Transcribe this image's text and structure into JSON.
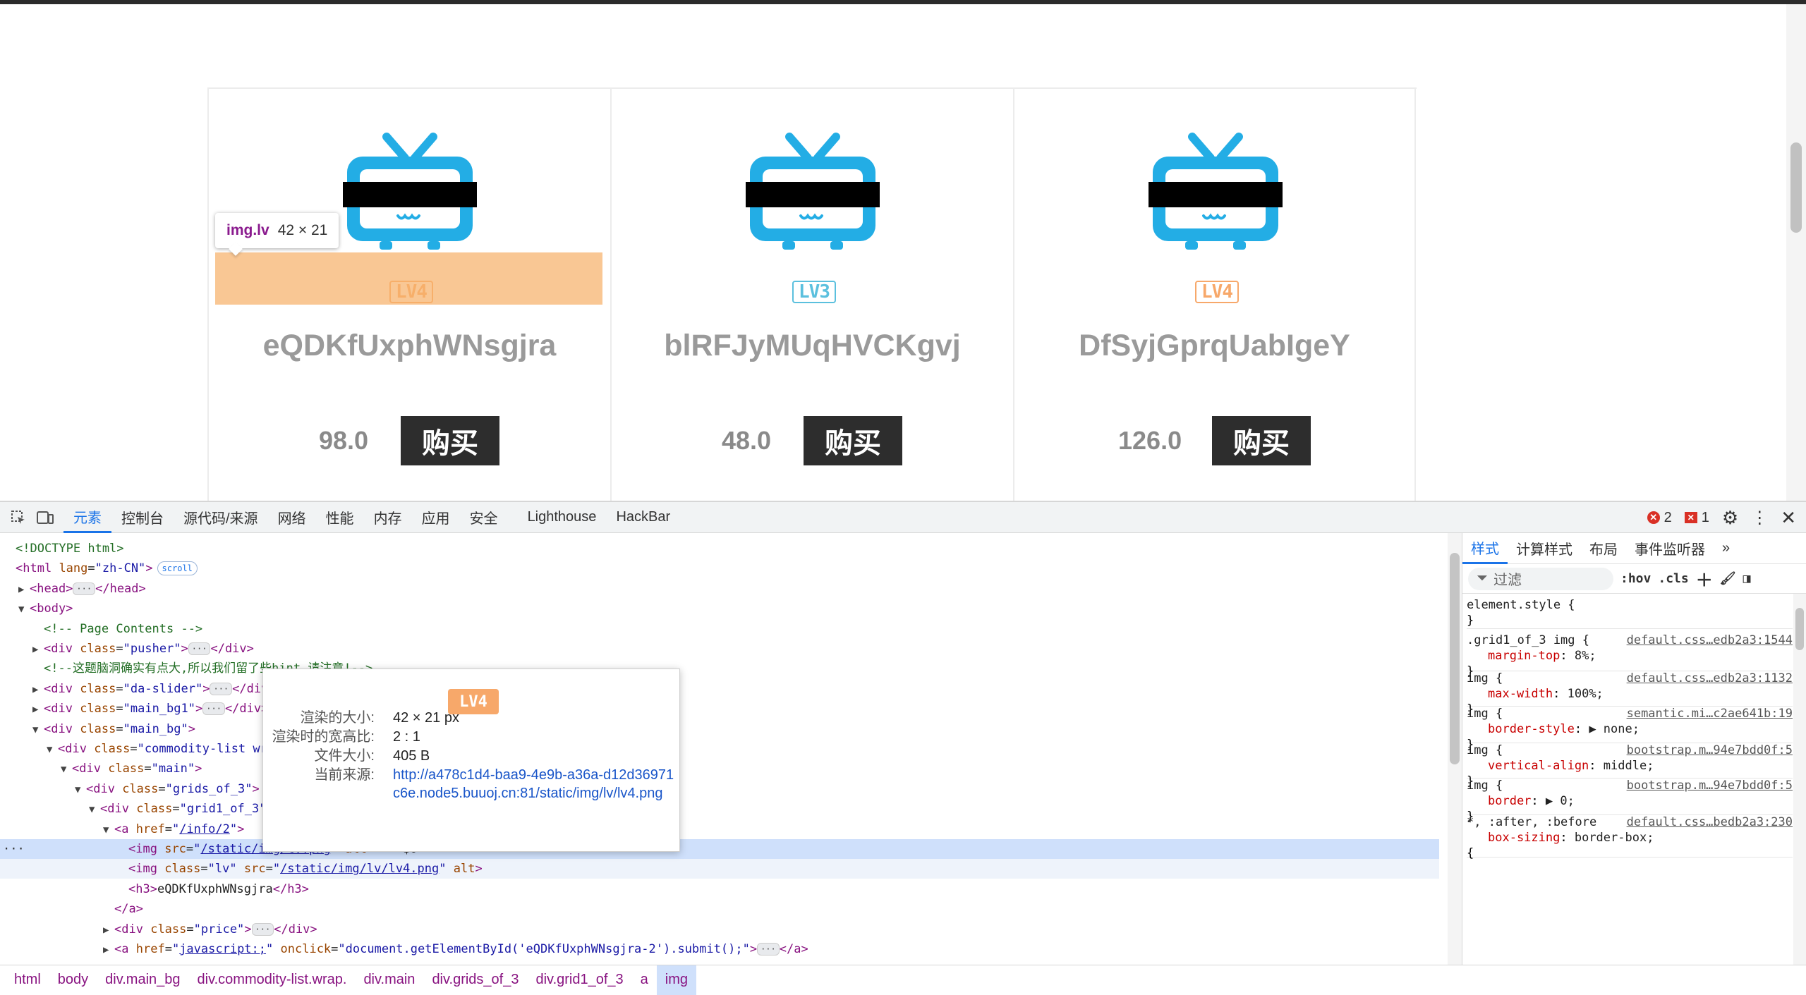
{
  "products": [
    {
      "level": "LV4",
      "level_color": "#f7a86a",
      "name": "eQDKfUxphWNsgjra",
      "price": "98.0",
      "buy_label": "购买"
    },
    {
      "level": "LV3",
      "level_color": "#5bc0de",
      "name": "blRFJyMUqHVCKgvj",
      "price": "48.0",
      "buy_label": "购买"
    },
    {
      "level": "LV4",
      "level_color": "#f7a86a",
      "name": "DfSyjGprqUabIgeY",
      "price": "126.0",
      "buy_label": "购买"
    }
  ],
  "hover_tip": {
    "selector": "img.lv",
    "size": "42 × 21"
  },
  "devtools": {
    "tabs": [
      "元素",
      "控制台",
      "源代码/来源",
      "网络",
      "性能",
      "内存",
      "应用",
      "安全",
      "Lighthouse",
      "HackBar"
    ],
    "error_count": "2",
    "issue_count": "1",
    "dom_lines": [
      {
        "indent": 0,
        "html": "<span class='cmt'>&lt;!DOCTYPE html&gt;</span>"
      },
      {
        "indent": 0,
        "html": "<span class='tag'>&lt;html</span> <span class='attr'>lang</span>=<span class='val'>\"zh-CN\"</span><span class='tag'>&gt;</span><span class='pill'>scroll</span>"
      },
      {
        "indent": 1,
        "arrow": "▶",
        "html": "<span class='tag'>&lt;head&gt;</span><span class='ell'>···</span><span class='tag'>&lt;/head&gt;</span>"
      },
      {
        "indent": 1,
        "arrow": "▼",
        "html": "<span class='tag'>&lt;body&gt;</span>"
      },
      {
        "indent": 2,
        "html": "<span class='cmt'>&lt;!-- Page Contents --&gt;</span>"
      },
      {
        "indent": 2,
        "arrow": "▶",
        "html": "<span class='tag'>&lt;div</span> <span class='attr'>class</span>=<span class='val'>\"pusher\"</span><span class='tag'>&gt;</span><span class='ell'>···</span><span class='tag'>&lt;/div&gt;</span>"
      },
      {
        "indent": 2,
        "html": "<span class='cmt'>&lt;!--这题脑洞确实有点大,所以我们留了些hint,请注意!--&gt;</span>"
      },
      {
        "indent": 2,
        "arrow": "▶",
        "html": "<span class='tag'>&lt;div</span> <span class='attr'>class</span>=<span class='val'>\"da-slider\"</span><span class='tag'>&gt;</span><span class='ell'>···</span><span class='tag'>&lt;/div&gt;</span>"
      },
      {
        "indent": 2,
        "arrow": "▶",
        "html": "<span class='tag'>&lt;div</span> <span class='attr'>class</span>=<span class='val'>\"main_bg1\"</span><span class='tag'>&gt;</span><span class='ell'>···</span><span class='tag'>&lt;/div&gt;</span>"
      },
      {
        "indent": 2,
        "arrow": "▼",
        "html": "<span class='tag'>&lt;div</span> <span class='attr'>class</span>=<span class='val'>\"main_bg\"</span><span class='tag'>&gt;</span>"
      },
      {
        "indent": 3,
        "arrow": "▼",
        "html": "<span class='tag'>&lt;div</span> <span class='attr'>class</span>=<span class='val'>\"commodity-list wrap\"</span><span class='tag'>&gt;</span>"
      },
      {
        "indent": 4,
        "arrow": "▼",
        "html": "<span class='tag'>&lt;div</span> <span class='attr'>class</span>=<span class='val'>\"main\"</span><span class='tag'>&gt;</span>"
      },
      {
        "indent": 5,
        "arrow": "▼",
        "html": "<span class='tag'>&lt;div</span> <span class='attr'>class</span>=<span class='val'>\"grids_of_3\"</span><span class='tag'>&gt;</span>"
      },
      {
        "indent": 6,
        "arrow": "▼",
        "html": "<span class='tag'>&lt;div</span> <span class='attr'>class</span>=<span class='val'>\"grid1_of_3\"</span><span class='tag'>&gt;</span>"
      },
      {
        "indent": 7,
        "arrow": "▼",
        "html": "<span class='tag'>&lt;a</span> <span class='attr'>href</span>=<span class='val'>\"<span class='link'>/info/2</span>\"</span><span class='tag'>&gt;</span>"
      },
      {
        "indent": 8,
        "sel": true,
        "html": "<span class='tag'>&lt;img</span> <span class='attr'>src</span>=<span class='val'>\"<span class='link'>/static/img/tv.png</span>\"</span> <span class='attr'>alt</span><span class='tag'>&gt;</span> == $0"
      },
      {
        "indent": 8,
        "hover": true,
        "html": "<span class='tag'>&lt;img</span> <span class='attr'>class</span>=<span class='val'>\"lv\"</span> <span class='attr'>src</span>=<span class='val'>\"<span class='link'>/static/img/lv/lv4.png</span>\"</span> <span class='attr'>alt</span><span class='tag'>&gt;</span>"
      },
      {
        "indent": 8,
        "html": "<span class='tag'>&lt;h3&gt;</span>eQDKfUxphWNsgjra<span class='tag'>&lt;/h3&gt;</span>"
      },
      {
        "indent": 7,
        "html": "<span class='tag'>&lt;/a&gt;</span>"
      },
      {
        "indent": 7,
        "arrow": "▶",
        "html": "<span class='tag'>&lt;div</span> <span class='attr'>class</span>=<span class='val'>\"price\"</span><span class='tag'>&gt;</span><span class='ell'>···</span><span class='tag'>&lt;/div&gt;</span>"
      },
      {
        "indent": 7,
        "arrow": "▶",
        "html": "<span class='tag'>&lt;a</span> <span class='attr'>href</span>=<span class='val'>\"<span class='link'>javascript:;</span>\"</span> <span class='attr'>onclick</span>=<span class='val'>\"document.getElementById('eQDKfUxphWNsgjra-2').submit();\"</span><span class='tag'>&gt;</span><span class='ell'>···</span><span class='tag'>&lt;/a&gt;</span>"
      }
    ],
    "image_tip": {
      "thumb_text": "LV4",
      "rows": [
        {
          "key": "渲染的大小:",
          "value": "42 × 21 px"
        },
        {
          "key": "渲染时的宽高比:",
          "value": "2 : 1"
        },
        {
          "key": "文件大小:",
          "value": "405 B"
        },
        {
          "key": "当前来源:",
          "value": "http://a478c1d4-baa9-4e9b-a36a-d12d36971c6e.node5.buuoj.cn:81/static/img/lv/lv4.png"
        }
      ]
    },
    "breadcrumb": [
      "html",
      "body",
      "div.main_bg",
      "div.commodity-list.wrap.",
      "div.main",
      "div.grids_of_3",
      "div.grid1_of_3",
      "a",
      "img"
    ],
    "styles_tabs": [
      "样式",
      "计算样式",
      "布局",
      "事件监听器"
    ],
    "filter_placeholder": "过滤",
    "filter_tools": [
      ":hov",
      ".cls"
    ],
    "rules": [
      {
        "selector": "element.style {",
        "source": "",
        "decls": [],
        "close": "}"
      },
      {
        "selector": ".grid1_of_3 img {",
        "source": "default.css…edb2a3:1544",
        "decls": [
          {
            "prop": "margin-top",
            "val": "8%;"
          }
        ],
        "close": "}"
      },
      {
        "selector": "img {",
        "source": "default.css…edb2a3:1132",
        "decls": [
          {
            "prop": "max-width",
            "val": "100%;"
          }
        ],
        "close": "}"
      },
      {
        "selector": "img {",
        "source": "semantic.mi…c2ae641b:19",
        "decls": [
          {
            "prop": "border-style",
            "val": "▶ none;"
          }
        ],
        "close": "}"
      },
      {
        "selector": "img {",
        "source": "bootstrap.m…94e7bdd0f:5",
        "decls": [
          {
            "prop": "vertical-align",
            "val": "middle;"
          }
        ],
        "close": "}"
      },
      {
        "selector": "img {",
        "source": "bootstrap.m…94e7bdd0f:5",
        "decls": [
          {
            "prop": "border",
            "val": "▶ 0;"
          }
        ],
        "close": "}"
      },
      {
        "selector": "*, :after, :before",
        "source": "default.css…bedb2a3:230",
        "decls": [
          {
            "prop": "box-sizing",
            "val": "border-box;"
          }
        ],
        "close": "{"
      }
    ]
  }
}
